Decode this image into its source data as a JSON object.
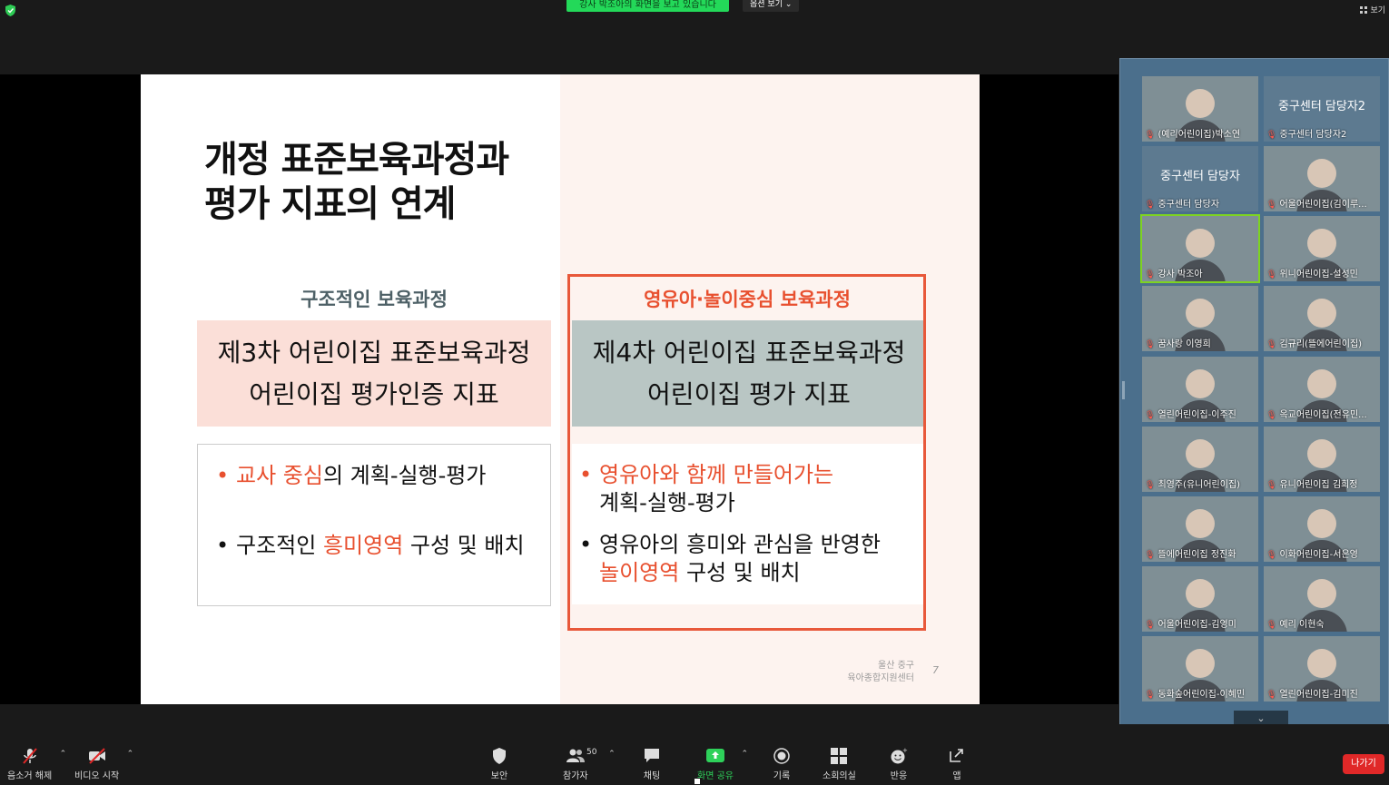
{
  "topbar": {
    "share_banner": "강사 박조아의 화면을 보고 있습니다",
    "view_options": "옵션 보기 ⌄",
    "view_label": "보기"
  },
  "slide": {
    "title": "개정 표준보육과정과 평가 지표의 연계",
    "title_line1": "개정 표준보육과정과",
    "title_line2": "평가 지표의 연계",
    "left": {
      "heading": "구조적인 보육과정",
      "box_line1": "제3차 어린이집 표준보육과정",
      "box_line2": "어린이집 평가인증 지표",
      "bullet1_highlight": "교사 중심",
      "bullet1_rest": "의 계획-실행-평가",
      "bullet2_pre": "구조적인 ",
      "bullet2_highlight": "흥미영역",
      "bullet2_post": " 구성 및 배치"
    },
    "right": {
      "heading": "영유아·놀이중심 보육과정",
      "box_line1": "제4차 어린이집 표준보육과정",
      "box_line2": "어린이집 평가 지표",
      "bullet1_highlight": "영유아와 함께 만들어가는",
      "bullet1_line2": "계획-실행-평가",
      "bullet2_line1": "영유아의 흥미와 관심을 반영한",
      "bullet2_highlight": "놀이영역",
      "bullet2_post": " 구성 및 배치"
    },
    "credit_line1": "울산 중구",
    "credit_line2": "육아종합지원센터",
    "page_number": "7"
  },
  "participants": [
    {
      "name": "(예리어린이집)박소연",
      "video": true
    },
    {
      "name": "중구센터 담당자2",
      "video": false,
      "center": "중구센터 담당자2"
    },
    {
      "name": "중구센터 담당자",
      "video": false,
      "center": "중구센터 담당자"
    },
    {
      "name": "어울어린이집(김이루...",
      "video": true
    },
    {
      "name": "강사 박조아",
      "video": true,
      "active": true
    },
    {
      "name": "위니어린이집-설성민",
      "video": true
    },
    {
      "name": "꿈사랑 이영희",
      "video": true
    },
    {
      "name": "김규리(뜰에어린이집)",
      "video": true
    },
    {
      "name": "열린어린이집-이주진",
      "video": true
    },
    {
      "name": "옥교어린이집(전유민...",
      "video": true
    },
    {
      "name": "최영주(유니어린이집)",
      "video": true
    },
    {
      "name": "유니어린이집 김희정",
      "video": true
    },
    {
      "name": "뜰에어린이집 정진화",
      "video": true
    },
    {
      "name": "이화어린이집-서은영",
      "video": true
    },
    {
      "name": "어울어린이집-김영미",
      "video": true
    },
    {
      "name": "예리 이현숙",
      "video": true
    },
    {
      "name": "동화숲어린이집-이혜민",
      "video": true
    },
    {
      "name": "열린어린이집-김미진",
      "video": true
    }
  ],
  "toolbar": {
    "mute": "음소거 해제",
    "video": "비디오 시작",
    "security": "보안",
    "participants": "참가자",
    "participant_count": "50",
    "chat": "채팅",
    "share": "화면 공유",
    "record": "기록",
    "breakout": "소회의실",
    "reactions": "반응",
    "apps": "앱",
    "leave": "나가기"
  },
  "colors": {
    "accent_orange": "#e8502f",
    "share_green": "#23d959",
    "leave_red": "#e02828",
    "gallery_bg": "#4b6f8c"
  }
}
